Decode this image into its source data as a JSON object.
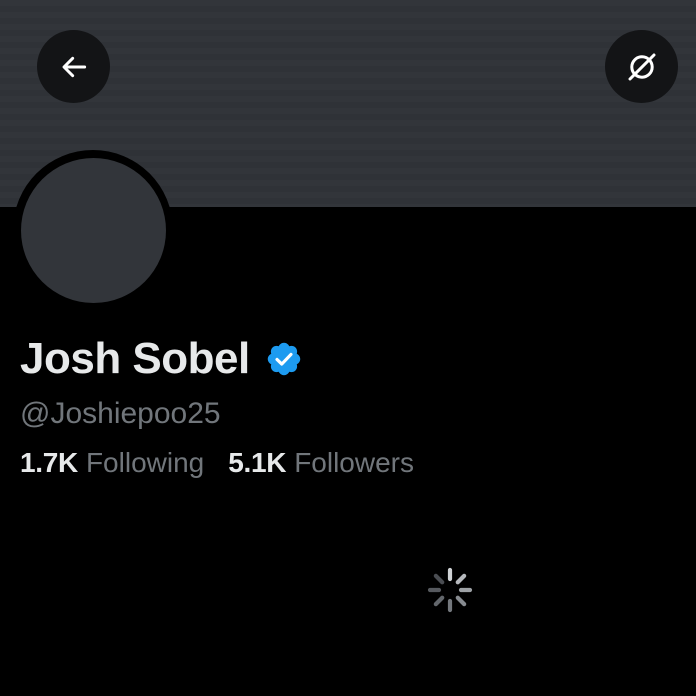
{
  "profile": {
    "display_name": "Josh Sobel",
    "handle": "@Joshiepoo25",
    "verified": true
  },
  "stats": {
    "following_count": "1.7K",
    "following_label": "Following",
    "followers_count": "5.1K",
    "followers_label": "Followers"
  },
  "icons": {
    "back": "arrow-left-icon",
    "top_right": "no-image-icon",
    "verified": "verified-badge-icon",
    "loading": "loading-spinner-icon"
  },
  "colors": {
    "background": "#000000",
    "banner": "#32353a",
    "primary_text": "#e7e9ea",
    "secondary_text": "#71767b",
    "verified_blue": "#1d9bf0"
  }
}
